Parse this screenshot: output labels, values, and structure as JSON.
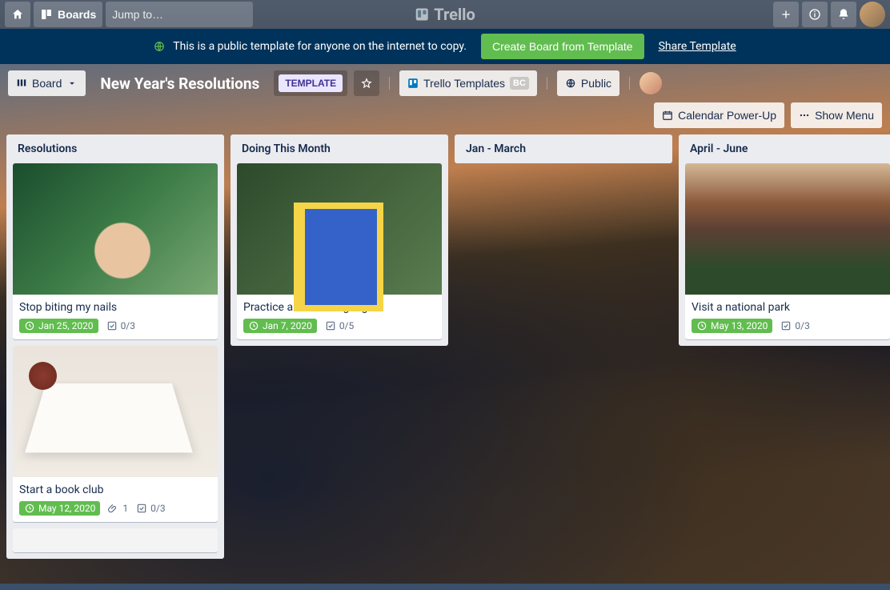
{
  "topbar": {
    "boards_label": "Boards",
    "search_placeholder": "Jump to…",
    "brand": "Trello"
  },
  "banner": {
    "msg": "This is a public template for anyone on the internet to copy.",
    "create_label": "Create Board from Template",
    "share_label": "Share Template"
  },
  "board_header": {
    "view_btn": "Board",
    "title": "New Year's Resolutions",
    "template_badge": "TEMPLATE",
    "workspace": "Trello Templates",
    "workspace_pill": "BC",
    "visibility": "Public",
    "calendar": "Calendar Power-Up",
    "menu": "Show Menu"
  },
  "lists": [
    {
      "title": "Resolutions",
      "cards": [
        {
          "title": "Stop biting my nails",
          "due": "Jan 25, 2020",
          "checklist": "0/3",
          "cover": "cover-hand"
        },
        {
          "title": "Start a book club",
          "due": "May 12, 2020",
          "attach": "1",
          "checklist": "0/3",
          "cover": "cover-book"
        }
      ],
      "extra_empty": true
    },
    {
      "title": "Doing This Month",
      "cards": [
        {
          "title": "Practice another language",
          "due": "Jan 7, 2020",
          "checklist": "0/5",
          "cover": "cover-cactus"
        }
      ]
    },
    {
      "title": "Jan - March",
      "cards": []
    },
    {
      "title": "April - June",
      "cards": [
        {
          "title": "Visit a national park",
          "due": "May 13, 2020",
          "checklist": "0/3",
          "cover": "cover-park"
        }
      ]
    }
  ]
}
